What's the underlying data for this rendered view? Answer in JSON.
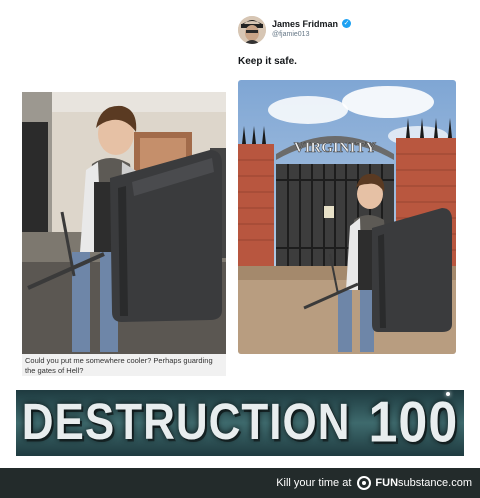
{
  "left_post": {
    "caption": "Could you put me somewhere cooler? Perhaps guarding the gates of Hell?"
  },
  "tweet": {
    "name": "James Fridman",
    "handle": "@fjamie013",
    "text": "Keep it safe.",
    "gate_sign": "VIRGINITY"
  },
  "banner": {
    "word": "DESTRUCTION",
    "number": "100"
  },
  "footer": {
    "tagline": "Kill your time at",
    "brand_prefix": "FUN",
    "brand_suffix": "substance.com"
  },
  "colors": {
    "footer_bg": "#232b2b",
    "verified": "#1da1f2",
    "banner_bg": "#2f5558"
  }
}
